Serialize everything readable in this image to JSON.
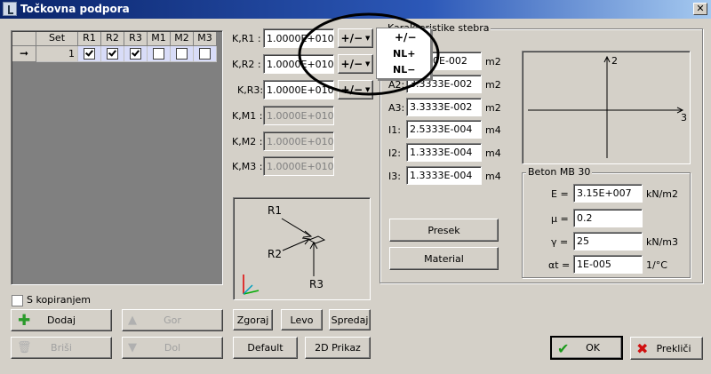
{
  "window": {
    "title": "Točkovna podpora",
    "close": "✕"
  },
  "grid": {
    "headers": [
      "Set",
      "R1",
      "R2",
      "R3",
      "M1",
      "M2",
      "M3"
    ],
    "row": {
      "indicator": "➞",
      "set": "1",
      "checks": [
        true,
        true,
        true,
        false,
        false,
        false
      ]
    }
  },
  "left": {
    "copy_label": "S kopiranjem",
    "add_label": "Dodaj",
    "up_label": "Gor",
    "delete_label": "Briši",
    "down_label": "Dol"
  },
  "springs": [
    {
      "label": "K,R1 :",
      "value": "1.0000E+010",
      "enabled": true
    },
    {
      "label": "K,R2 :",
      "value": "1.0000E+010",
      "enabled": true
    },
    {
      "label": "K,R3:",
      "value": "1.0000E+010",
      "enabled": true
    },
    {
      "label": "K,M1 :",
      "value": "1.0000E+010",
      "enabled": false
    },
    {
      "label": "K,M2 :",
      "value": "1.0000E+010",
      "enabled": false
    },
    {
      "label": "K,M3 :",
      "value": "1.0000E+010",
      "enabled": false
    }
  ],
  "type_button": {
    "label": "+/−"
  },
  "popup": {
    "items": [
      "+/−",
      "NL+",
      "NL−"
    ]
  },
  "diagram": {
    "labels": {
      "r1": "R1",
      "r2": "R2",
      "r3": "R3"
    }
  },
  "view_buttons": {
    "top": "Zgoraj",
    "left": "Levo",
    "front": "Spredaj",
    "default": "Default",
    "view2d": "2D Prikaz"
  },
  "section": {
    "title": "Karakteristike stebra",
    "props": [
      {
        "label": "",
        "value": "00E-002",
        "unit": "m2"
      },
      {
        "label": "A2:",
        "value": "3.3333E-002",
        "unit": "m2"
      },
      {
        "label": "A3:",
        "value": "3.3333E-002",
        "unit": "m2"
      },
      {
        "label": "I1:",
        "value": "2.5333E-004",
        "unit": "m4"
      },
      {
        "label": "I2:",
        "value": "1.3333E-004",
        "unit": "m4"
      },
      {
        "label": "I3:",
        "value": "1.3333E-004",
        "unit": "m4"
      }
    ],
    "presek_label": "Presek",
    "material_label": "Material",
    "axes": {
      "y": "2",
      "x": "3"
    }
  },
  "material": {
    "title": "Beton MB 30",
    "props": [
      {
        "label": "E =",
        "value": "3.15E+007",
        "unit": "kN/m2"
      },
      {
        "label": "μ =",
        "value": "0.2",
        "unit": ""
      },
      {
        "label": "γ =",
        "value": "25",
        "unit": "kN/m3"
      },
      {
        "label": "αt =",
        "value": "1E-005",
        "unit": "1/°C"
      }
    ]
  },
  "footer": {
    "ok_label": "OK",
    "cancel_label": "Prekliči"
  }
}
